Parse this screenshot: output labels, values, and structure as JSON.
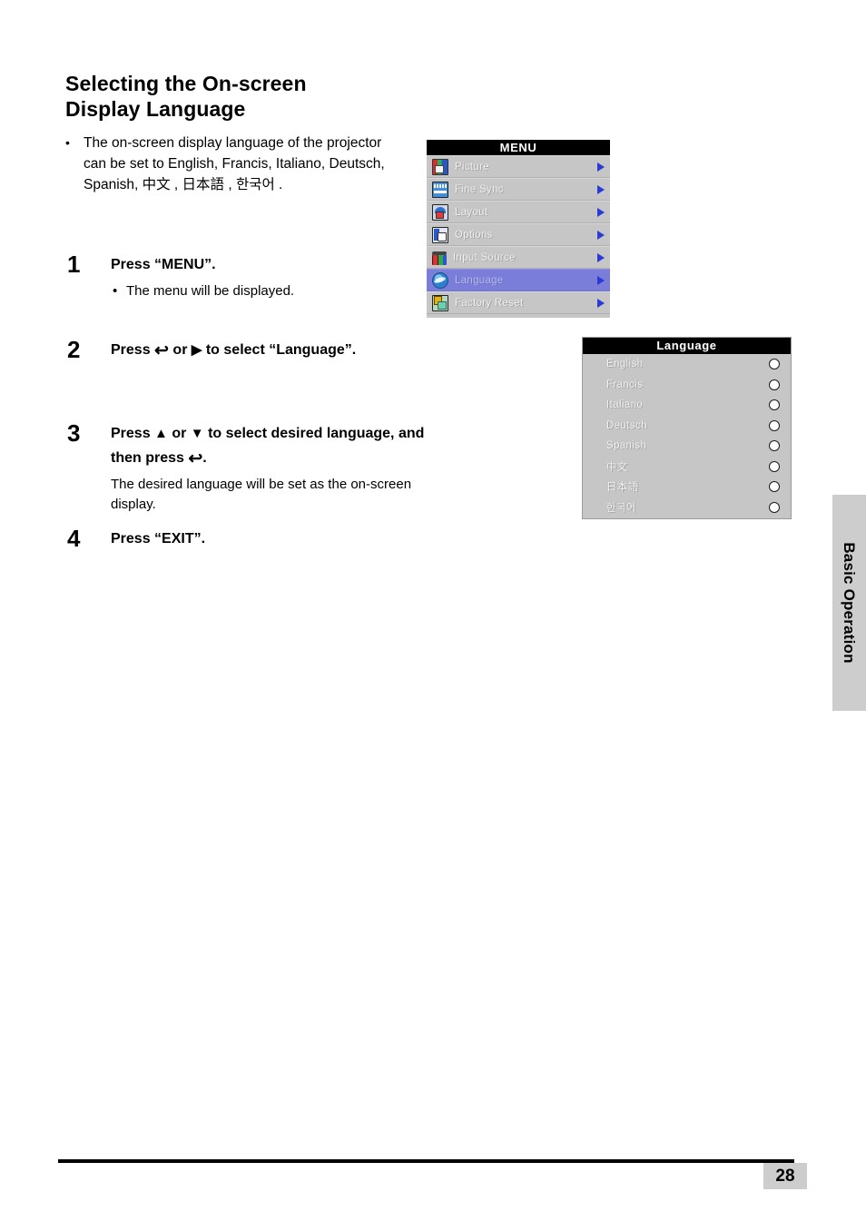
{
  "page": {
    "title_line1": "Selecting the On-screen",
    "title_line2": "Display Language",
    "number": "28",
    "side_tab": "Basic Operation"
  },
  "intro": {
    "bullet": "•",
    "text": "The on-screen display language of the projector can be set to English, Francis, Italiano, Deutsch, Spanish, 中文 , 日本語 , 한국어 ."
  },
  "steps": [
    {
      "num": "1",
      "head": "Press “MENU”.",
      "sub": "The menu will be displayed.",
      "sub_style": "bullet"
    },
    {
      "num": "2",
      "head_pre": "Press ",
      "head_glyph1": "↩",
      "head_mid": " or ",
      "head_glyph2": "▶",
      "head_post": " to select “Language”.",
      "sub": "",
      "sub_style": "none"
    },
    {
      "num": "3",
      "head_pre": "Press ",
      "head_glyph1": "▲",
      "head_mid": " or ",
      "head_glyph2": "▼",
      "head_post": " to select desired language, and then press ",
      "head_glyph3": "↩",
      "head_end": ".",
      "sub": "The desired language will be set as the on-screen display.",
      "sub_style": "plain"
    },
    {
      "num": "4",
      "head": "Press “EXIT”.",
      "sub": "",
      "sub_style": "none"
    }
  ],
  "menu_osd": {
    "title": "MENU",
    "highlight_color": "#7b7ed8",
    "background_color": "#c6c6c6",
    "rows": [
      {
        "label": "Picture",
        "icon": "picture-icon",
        "selected": false,
        "arrow": true
      },
      {
        "label": "Fine Sync",
        "icon": "fine-sync-icon",
        "selected": false,
        "arrow": true
      },
      {
        "label": "Layout",
        "icon": "layout-icon",
        "selected": false,
        "arrow": true
      },
      {
        "label": "Options",
        "icon": "options-icon",
        "selected": false,
        "arrow": true
      },
      {
        "label": "Input Source",
        "icon": "input-source-icon",
        "selected": false,
        "arrow": true
      },
      {
        "label": "Language",
        "icon": "language-icon",
        "selected": true,
        "arrow": true
      },
      {
        "label": "Factory Reset",
        "icon": "factory-reset-icon",
        "selected": false,
        "arrow": true
      }
    ]
  },
  "language_osd": {
    "title": "Language",
    "background_color": "#c6c6c6",
    "rows": [
      {
        "label": "English",
        "selected": false
      },
      {
        "label": "Francis",
        "selected": false
      },
      {
        "label": "Italiano",
        "selected": false
      },
      {
        "label": "Deutsch",
        "selected": false
      },
      {
        "label": "Spanish",
        "selected": false
      },
      {
        "label": "中文",
        "selected": false
      },
      {
        "label": "日本語",
        "selected": false
      },
      {
        "label": "한국어",
        "selected": false
      }
    ]
  }
}
